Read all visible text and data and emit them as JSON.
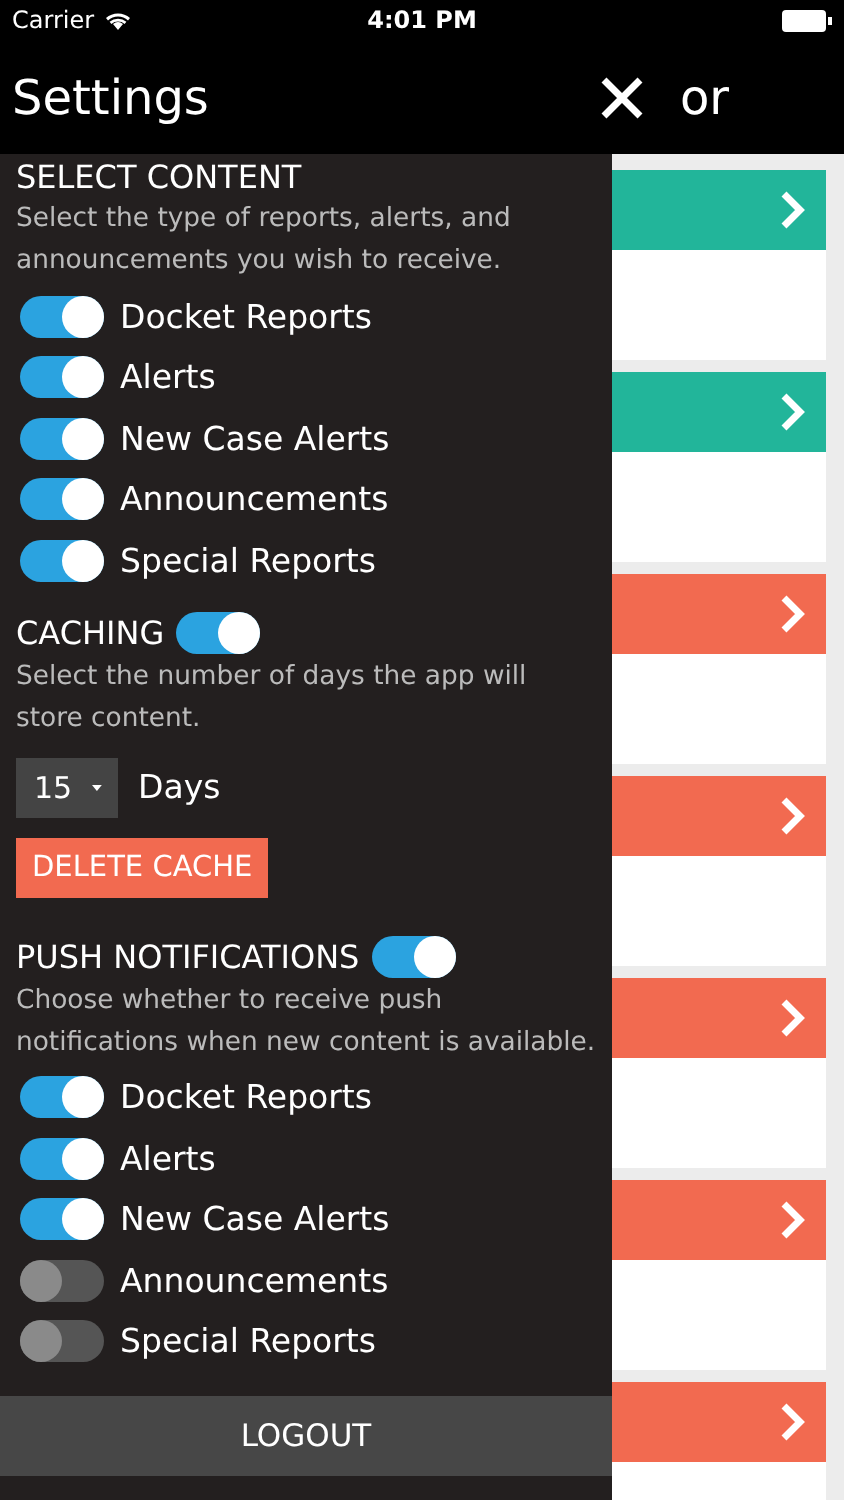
{
  "status_bar": {
    "carrier": "Carrier",
    "time": "4:01 PM"
  },
  "header": {
    "title": "Settings",
    "title_fragment": "or"
  },
  "cards": [
    {
      "color": "#22b59a"
    },
    {
      "color": "#22b59a"
    },
    {
      "color": "#f26a50"
    },
    {
      "color": "#f26a50"
    },
    {
      "color": "#f26a50"
    },
    {
      "color": "#f26a50"
    },
    {
      "color": "#f26a50"
    }
  ],
  "settings": {
    "sections": [
      {
        "kind": "toggles",
        "title": "SELECT CONTENT",
        "description": "Select the type of reports, alerts, and announcements you wish to receive.",
        "toggles": [
          {
            "label": "Docket Reports",
            "on": true
          },
          {
            "label": "Alerts",
            "on": true
          },
          {
            "label": "New Case Alerts",
            "on": true
          },
          {
            "label": "Announcements",
            "on": true
          },
          {
            "label": "Special Reports",
            "on": true
          }
        ]
      },
      {
        "kind": "caching",
        "title": "CACHING",
        "on": true,
        "description": "Select the number of days the app will store content.",
        "days": "15",
        "unit": "Days",
        "button": "DELETE CACHE"
      },
      {
        "kind": "toggles",
        "title": "PUSH NOTIFICATIONS",
        "on": true,
        "description": "Choose whether to receive push notifications when new content is available.",
        "toggles": [
          {
            "label": "Docket Reports",
            "on": true
          },
          {
            "label": "Alerts",
            "on": true
          },
          {
            "label": "New Case Alerts",
            "on": true
          },
          {
            "label": "Announcements",
            "on": false
          },
          {
            "label": "Special Reports",
            "on": false
          }
        ]
      }
    ],
    "logout": "LOGOUT"
  }
}
